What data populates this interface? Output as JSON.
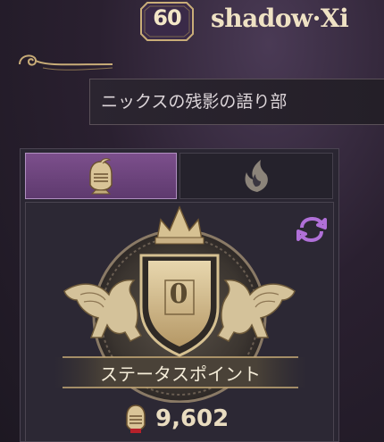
{
  "player": {
    "level": "60",
    "name": "shadow·Xi"
  },
  "title": {
    "text": "ニックスの残影の語り部"
  },
  "tabs": [
    {
      "id": "knight",
      "icon": "knight-helmet-icon",
      "active": true
    },
    {
      "id": "guild",
      "icon": "flame-leaf-icon",
      "active": false
    }
  ],
  "crest": {
    "shield_value": "0",
    "stat_label": "ステータスポイント"
  },
  "points": {
    "icon": "knight-token-icon",
    "value": "9,602"
  },
  "colors": {
    "accent_purple": "#7c4f8c",
    "gold": "#c9ad78",
    "refresh": "#b070d8"
  }
}
